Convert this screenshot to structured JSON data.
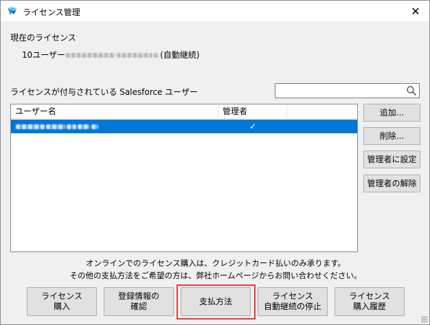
{
  "window": {
    "title": "ライセンス管理",
    "close_glyph": "✕"
  },
  "current_license": {
    "heading": "現在のライセンス",
    "prefix": "10ユーザー",
    "suffix": "(自動継続)"
  },
  "users_section": {
    "label": "ライセンスが付与されている Salesforce ユーザー",
    "search_value": ""
  },
  "table": {
    "columns": [
      "ユーザー名",
      "管理者",
      ""
    ],
    "rows": [
      {
        "username": "",
        "is_admin_mark": "✓"
      }
    ]
  },
  "side_buttons": {
    "add": "追加...",
    "delete": "削除...",
    "set_admin": "管理者に設定",
    "remove_admin": "管理者の解除"
  },
  "notice": {
    "line1": "オンラインでのライセンス購入は、クレジットカード払いのみ承ります。",
    "line2": "その他の支払方法をご希望の方は、弊社ホームページからお問い合わせください。"
  },
  "bottom_buttons": {
    "purchase": {
      "line1": "ライセンス",
      "line2": "購入"
    },
    "confirm_registration": {
      "line1": "登録情報の",
      "line2": "確認"
    },
    "payment_method": {
      "line1": "支払方法"
    },
    "stop_auto_renew": {
      "line1": "ライセンス",
      "line2": "自動継続の停止"
    },
    "purchase_history": {
      "line1": "ライセンス",
      "line2": "購入履歴"
    }
  },
  "colors": {
    "selection": "#0078d7",
    "highlight_border": "#e53935",
    "button_face": "#e1e1e1"
  },
  "icons": {
    "app": "salesforce-bird-icon",
    "search": "magnifier-icon",
    "close": "close-icon"
  }
}
